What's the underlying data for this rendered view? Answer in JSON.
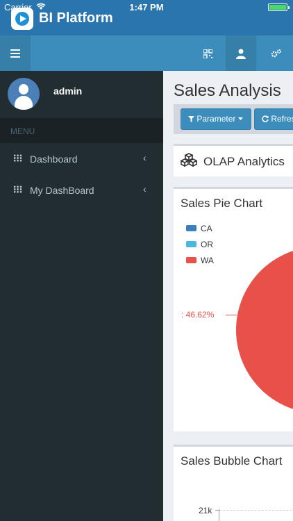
{
  "status_bar": {
    "carrier": "Carrier",
    "time": "1:47 PM"
  },
  "app": {
    "title": "BI Platform"
  },
  "navbar": {
    "icons": [
      "menu-icon",
      "qrcode-icon",
      "user-icon",
      "settings-icon"
    ]
  },
  "sidebar": {
    "username": "admin",
    "menu_header": "MENU",
    "items": [
      {
        "label": "Dashboard",
        "icon": "grid-icon"
      },
      {
        "label": "My DashBoard",
        "icon": "grid-icon"
      }
    ],
    "chevron": "‹"
  },
  "main": {
    "page_title": "Sales Analysis",
    "toolbar": {
      "parameter_label": "Parameter",
      "refresh_label": "Refresh"
    },
    "olap_title": "OLAP Analytics",
    "pie_title": "Sales Pie Chart",
    "bubble_title": "Sales Bubble Chart"
  },
  "chart_data": [
    {
      "type": "pie",
      "title": "Sales Pie Chart",
      "categories": [
        "CA",
        "OR",
        "WA"
      ],
      "values": [
        null,
        null,
        46.62
      ],
      "colors": [
        "#3a7fbf",
        "#4cb7e0",
        "#e8514a"
      ],
      "data_labels": [
        ": 46.62%"
      ],
      "legend": "top-left"
    },
    {
      "type": "scatter",
      "title": "Sales Bubble Chart",
      "ytick_labels": [
        "21k"
      ]
    }
  ]
}
